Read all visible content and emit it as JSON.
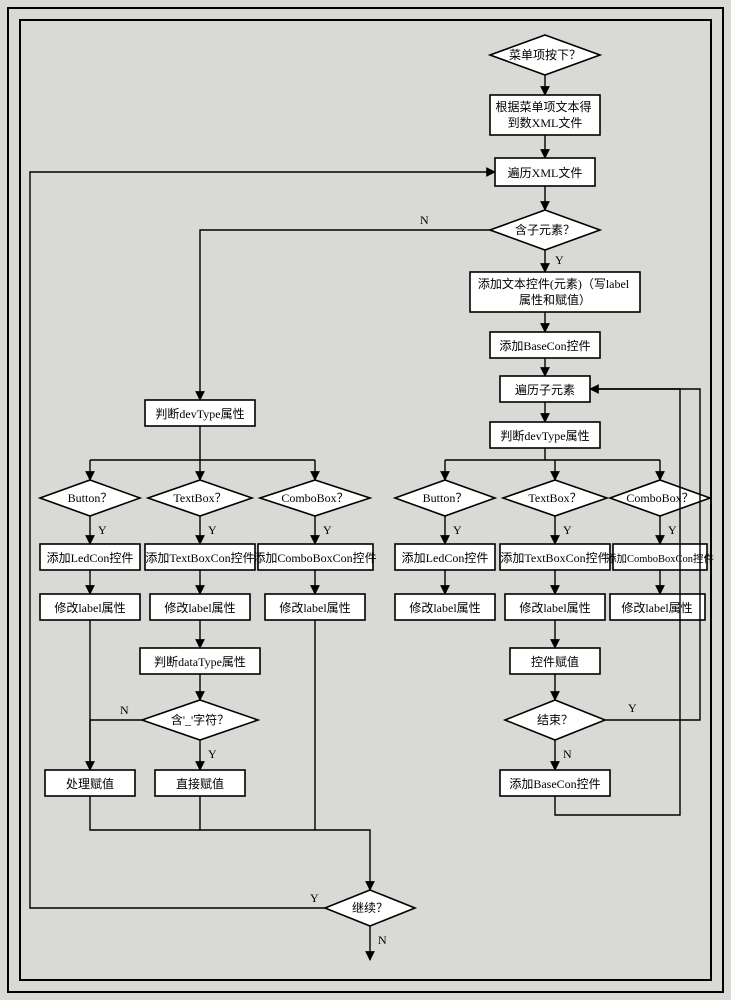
{
  "diagram": {
    "decisions": {
      "menu_pressed": "菜单项按下？",
      "has_child": "含子元素？",
      "dev_type_left": "判断devType属性",
      "dev_type_right": "判断devType属性",
      "button_left": "Button？",
      "textbox_left": "TextBox？",
      "combobox_left": "ComboBox？",
      "button_right": "Button？",
      "textbox_right": "TextBox？",
      "combobox_right": "ComboBox？",
      "data_type": "判断dataType属性",
      "has_underscore": "含'_'字符？",
      "finished": "结束？",
      "continue": "继续？"
    },
    "processes": {
      "get_xml": "根据菜单项文本得到数XML文件",
      "traverse_xml": "遍历XML文件",
      "add_text_ctrl": "添加文本控件(元素)（写label属性和赋值）",
      "add_basecon": "添加BaseCon控件",
      "add_basecon2": "添加BaseCon控件",
      "traverse_children": "遍历子元素",
      "add_ledcon_left": "添加LedCon控件",
      "add_textboxcon_left": "添加TextBoxCon控件",
      "add_comboboxcon_left": "添加ComboBoxCon控件",
      "modify_label_l1": "修改label属性",
      "modify_label_l2": "修改label属性",
      "modify_label_l3": "修改label属性",
      "add_ledcon_right": "添加LedCon控件",
      "add_textboxcon_right": "添加TextBoxCon控件",
      "add_comboboxcon_right": "添加ComboBoxCon控件",
      "modify_label_r1": "修改label属性",
      "modify_label_r2": "修改label属性",
      "modify_label_r3": "修改label属性",
      "control_assign": "控件赋值",
      "process_assign": "处理赋值",
      "direct_assign": "直接赋值"
    },
    "labels": {
      "Y": "Y",
      "N": "N"
    }
  },
  "chart_data": {
    "type": "flowchart",
    "nodes": [
      {
        "id": "d_menu",
        "type": "decision",
        "text": "菜单项按下？"
      },
      {
        "id": "p_getxml",
        "type": "process",
        "text": "根据菜单项文本得到数XML文件"
      },
      {
        "id": "p_traverse",
        "type": "process",
        "text": "遍历XML文件"
      },
      {
        "id": "d_haschild",
        "type": "decision",
        "text": "含子元素？"
      },
      {
        "id": "p_addtext",
        "type": "process",
        "text": "添加文本控件(元素)（写label属性和赋值）"
      },
      {
        "id": "p_addbase",
        "type": "process",
        "text": "添加BaseCon控件"
      },
      {
        "id": "p_travchild",
        "type": "process",
        "text": "遍历子元素"
      },
      {
        "id": "p_devtype_r",
        "type": "process",
        "text": "判断devType属性"
      },
      {
        "id": "d_button_r",
        "type": "decision",
        "text": "Button？"
      },
      {
        "id": "d_textbox_r",
        "type": "decision",
        "text": "TextBox？"
      },
      {
        "id": "d_combobox_r",
        "type": "decision",
        "text": "ComboBox？"
      },
      {
        "id": "p_led_r",
        "type": "process",
        "text": "添加LedCon控件"
      },
      {
        "id": "p_tbx_r",
        "type": "process",
        "text": "添加TextBoxCon控件"
      },
      {
        "id": "p_cbx_r",
        "type": "process",
        "text": "添加ComboBoxCon控件"
      },
      {
        "id": "p_mod_r1",
        "type": "process",
        "text": "修改label属性"
      },
      {
        "id": "p_mod_r2",
        "type": "process",
        "text": "修改label属性"
      },
      {
        "id": "p_mod_r3",
        "type": "process",
        "text": "修改label属性"
      },
      {
        "id": "p_ctlassign",
        "type": "process",
        "text": "控件赋值"
      },
      {
        "id": "d_finished",
        "type": "decision",
        "text": "结束？"
      },
      {
        "id": "p_addbase2",
        "type": "process",
        "text": "添加BaseCon控件"
      },
      {
        "id": "p_devtype_l",
        "type": "process",
        "text": "判断devType属性"
      },
      {
        "id": "d_button_l",
        "type": "decision",
        "text": "Button？"
      },
      {
        "id": "d_textbox_l",
        "type": "decision",
        "text": "TextBox？"
      },
      {
        "id": "d_combobox_l",
        "type": "decision",
        "text": "ComboBox？"
      },
      {
        "id": "p_led_l",
        "type": "process",
        "text": "添加LedCon控件"
      },
      {
        "id": "p_tbx_l",
        "type": "process",
        "text": "添加TextBoxCon控件"
      },
      {
        "id": "p_cbx_l",
        "type": "process",
        "text": "添加ComboBoxCon控件"
      },
      {
        "id": "p_mod_l1",
        "type": "process",
        "text": "修改label属性"
      },
      {
        "id": "p_mod_l2",
        "type": "process",
        "text": "修改label属性"
      },
      {
        "id": "p_mod_l3",
        "type": "process",
        "text": "修改label属性"
      },
      {
        "id": "p_datatype",
        "type": "process",
        "text": "判断dataType属性"
      },
      {
        "id": "d_underscore",
        "type": "decision",
        "text": "含'_'字符？"
      },
      {
        "id": "p_proc_assign",
        "type": "process",
        "text": "处理赋值"
      },
      {
        "id": "p_direct_assign",
        "type": "process",
        "text": "直接赋值"
      },
      {
        "id": "d_continue",
        "type": "decision",
        "text": "继续？"
      }
    ],
    "edges": [
      {
        "from": "d_menu",
        "to": "p_getxml",
        "label": ""
      },
      {
        "from": "p_getxml",
        "to": "p_traverse"
      },
      {
        "from": "p_traverse",
        "to": "d_haschild"
      },
      {
        "from": "d_haschild",
        "to": "p_addtext",
        "label": "Y"
      },
      {
        "from": "d_haschild",
        "to": "p_devtype_l",
        "label": "N"
      },
      {
        "from": "p_addtext",
        "to": "p_addbase"
      },
      {
        "from": "p_addbase",
        "to": "p_travchild"
      },
      {
        "from": "p_travchild",
        "to": "p_devtype_r"
      },
      {
        "from": "p_devtype_r",
        "to": "d_button_r"
      },
      {
        "from": "p_devtype_r",
        "to": "d_textbox_r"
      },
      {
        "from": "p_devtype_r",
        "to": "d_combobox_r"
      },
      {
        "from": "d_button_r",
        "to": "p_led_r",
        "label": "Y"
      },
      {
        "from": "d_textbox_r",
        "to": "p_tbx_r",
        "label": "Y"
      },
      {
        "from": "d_combobox_r",
        "to": "p_cbx_r",
        "label": "Y"
      },
      {
        "from": "p_led_r",
        "to": "p_mod_r1"
      },
      {
        "from": "p_tbx_r",
        "to": "p_mod_r2"
      },
      {
        "from": "p_cbx_r",
        "to": "p_mod_r3"
      },
      {
        "from": "p_mod_r2",
        "to": "p_ctlassign"
      },
      {
        "from": "p_ctlassign",
        "to": "d_finished"
      },
      {
        "from": "d_finished",
        "to": "p_addbase2",
        "label": "N"
      },
      {
        "from": "d_finished",
        "to": "p_travchild",
        "label": "Y"
      },
      {
        "from": "p_addbase2",
        "to": "p_travchild"
      },
      {
        "from": "p_devtype_l",
        "to": "d_button_l"
      },
      {
        "from": "p_devtype_l",
        "to": "d_textbox_l"
      },
      {
        "from": "p_devtype_l",
        "to": "d_combobox_l"
      },
      {
        "from": "d_button_l",
        "to": "p_led_l",
        "label": "Y"
      },
      {
        "from": "d_textbox_l",
        "to": "p_tbx_l",
        "label": "Y"
      },
      {
        "from": "d_combobox_l",
        "to": "p_cbx_l",
        "label": "Y"
      },
      {
        "from": "p_led_l",
        "to": "p_mod_l1"
      },
      {
        "from": "p_tbx_l",
        "to": "p_mod_l2"
      },
      {
        "from": "p_cbx_l",
        "to": "p_mod_l3"
      },
      {
        "from": "p_mod_l2",
        "to": "p_datatype"
      },
      {
        "from": "p_datatype",
        "to": "d_underscore"
      },
      {
        "from": "d_underscore",
        "to": "p_direct_assign",
        "label": "Y"
      },
      {
        "from": "d_underscore",
        "to": "p_proc_assign",
        "label": "N"
      },
      {
        "from": "p_proc_assign",
        "to": "d_continue"
      },
      {
        "from": "p_direct_assign",
        "to": "d_continue"
      },
      {
        "from": "d_continue",
        "to": "p_traverse",
        "label": "Y"
      },
      {
        "from": "d_continue",
        "to": "end",
        "label": "N"
      }
    ]
  }
}
